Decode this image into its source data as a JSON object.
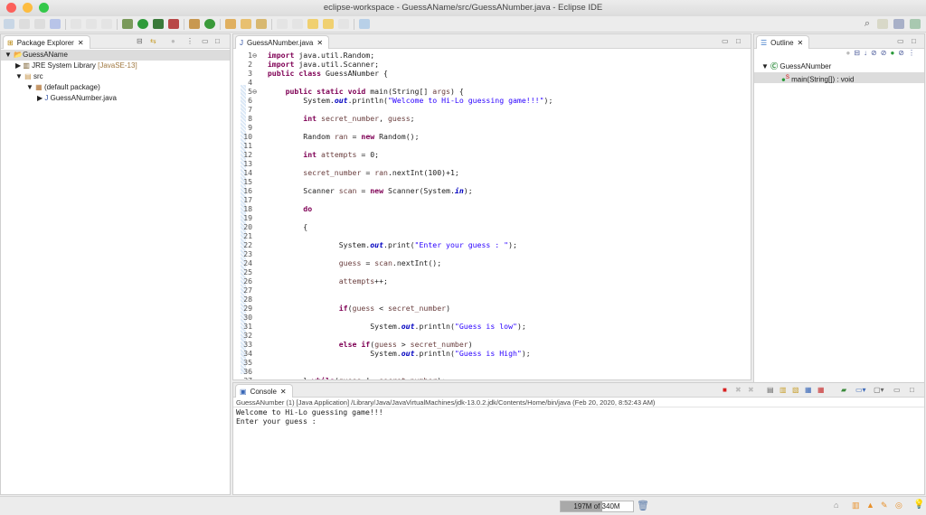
{
  "window": {
    "title": "eclipse-workspace - GuessAName/src/GuessANumber.java - Eclipse IDE"
  },
  "package_explorer": {
    "tab_label": "Package Explorer",
    "tree": [
      {
        "label": "GuessAName",
        "icon": "project-folder-icon"
      },
      {
        "label": "JRE System Library",
        "suffix": "[JavaSE-13]",
        "icon": "library-icon"
      },
      {
        "label": "src",
        "icon": "source-folder-icon"
      },
      {
        "label": "(default package)",
        "icon": "package-icon"
      },
      {
        "label": "GuessANumber.java",
        "icon": "java-file-icon"
      }
    ]
  },
  "editor": {
    "tab_label": "GuessANumber.java",
    "lines": [
      [
        [
          "import",
          "kw"
        ],
        [
          " java.util.Random;",
          ""
        ]
      ],
      [
        [
          "import",
          "kw"
        ],
        [
          " java.util.Scanner;",
          ""
        ]
      ],
      [
        [
          "public class",
          "kw"
        ],
        [
          " GuessANumber {",
          ""
        ]
      ],
      [],
      [
        [
          "    ",
          ""
        ],
        [
          "public static void",
          "kw"
        ],
        [
          " main(String[] ",
          ""
        ],
        [
          "args",
          "var"
        ],
        [
          ") {",
          ""
        ]
      ],
      [
        [
          "        System.",
          ""
        ],
        [
          "out",
          "fld"
        ],
        [
          ".println(",
          ""
        ],
        [
          "\"Welcome to Hi-Lo guessing game!!!\"",
          "str"
        ],
        [
          ");",
          ""
        ]
      ],
      [],
      [
        [
          "        ",
          ""
        ],
        [
          "int",
          "kw"
        ],
        [
          " ",
          ""
        ],
        [
          "secret_number",
          "var"
        ],
        [
          ", ",
          ""
        ],
        [
          "guess",
          "var"
        ],
        [
          ";",
          ""
        ]
      ],
      [],
      [
        [
          "        Random ",
          ""
        ],
        [
          "ran",
          "var"
        ],
        [
          " = ",
          ""
        ],
        [
          "new",
          "kw"
        ],
        [
          " Random();",
          ""
        ]
      ],
      [],
      [
        [
          "        ",
          ""
        ],
        [
          "int",
          "kw"
        ],
        [
          " ",
          ""
        ],
        [
          "attempts",
          "var"
        ],
        [
          " = 0;",
          ""
        ]
      ],
      [],
      [
        [
          "        ",
          ""
        ],
        [
          "secret_number",
          "var"
        ],
        [
          " = ",
          ""
        ],
        [
          "ran",
          "var"
        ],
        [
          ".nextInt(100)+1;",
          ""
        ]
      ],
      [],
      [
        [
          "        Scanner ",
          ""
        ],
        [
          "scan",
          "var"
        ],
        [
          " = ",
          ""
        ],
        [
          "new",
          "kw"
        ],
        [
          " Scanner(System.",
          ""
        ],
        [
          "in",
          "fld"
        ],
        [
          ");",
          ""
        ]
      ],
      [],
      [
        [
          "        ",
          ""
        ],
        [
          "do",
          "kw"
        ]
      ],
      [],
      [
        [
          "        {",
          ""
        ]
      ],
      [],
      [
        [
          "                System.",
          ""
        ],
        [
          "out",
          "fld"
        ],
        [
          ".print(",
          ""
        ],
        [
          "\"Enter your guess : \"",
          "str"
        ],
        [
          ");",
          ""
        ]
      ],
      [],
      [
        [
          "                ",
          ""
        ],
        [
          "guess",
          "var"
        ],
        [
          " = ",
          ""
        ],
        [
          "scan",
          "var"
        ],
        [
          ".nextInt();",
          ""
        ]
      ],
      [],
      [
        [
          "                ",
          ""
        ],
        [
          "attempts",
          "var"
        ],
        [
          "++;",
          ""
        ]
      ],
      [],
      [],
      [
        [
          "                ",
          ""
        ],
        [
          "if",
          "kw"
        ],
        [
          "(",
          ""
        ],
        [
          "guess",
          "var"
        ],
        [
          " < ",
          ""
        ],
        [
          "secret_number",
          "var"
        ],
        [
          ")",
          ""
        ]
      ],
      [],
      [
        [
          "                       System.",
          ""
        ],
        [
          "out",
          "fld"
        ],
        [
          ".println(",
          ""
        ],
        [
          "\"Guess is low\"",
          "str"
        ],
        [
          ");",
          ""
        ]
      ],
      [],
      [
        [
          "                ",
          ""
        ],
        [
          "else if",
          "kw"
        ],
        [
          "(",
          ""
        ],
        [
          "guess",
          "var"
        ],
        [
          " > ",
          ""
        ],
        [
          "secret_number",
          "var"
        ],
        [
          ")",
          ""
        ]
      ],
      [
        [
          "                       System.",
          ""
        ],
        [
          "out",
          "fld"
        ],
        [
          ".println(",
          ""
        ],
        [
          "\"Guess is High\"",
          "str"
        ],
        [
          ");",
          ""
        ]
      ],
      [],
      [],
      [
        [
          "        } ",
          ""
        ],
        [
          "while",
          "kw"
        ],
        [
          "(",
          ""
        ],
        [
          "guess",
          "var"
        ],
        [
          " != ",
          ""
        ],
        [
          "secret_number",
          "var"
        ],
        [
          ");",
          ""
        ]
      ]
    ]
  },
  "outline": {
    "tab_label": "Outline",
    "items": [
      {
        "label": "GuessANumber"
      },
      {
        "label": "main(String[]) : void"
      }
    ]
  },
  "console": {
    "tab_label": "Console",
    "launch_info": "GuessANumber (1) [Java Application] /Library/Java/JavaVirtualMachines/jdk-13.0.2.jdk/Contents/Home/bin/java (Feb 20, 2020, 8:52:43 AM)",
    "output": [
      "Welcome to Hi-Lo guessing game!!!",
      "Enter your guess :"
    ]
  },
  "status": {
    "memory_label": "197M of 340M",
    "memory_used_fraction": 0.58
  },
  "colors": {
    "keyword": "#7f0055",
    "string": "#2a00ff",
    "field": "#0000c0"
  }
}
